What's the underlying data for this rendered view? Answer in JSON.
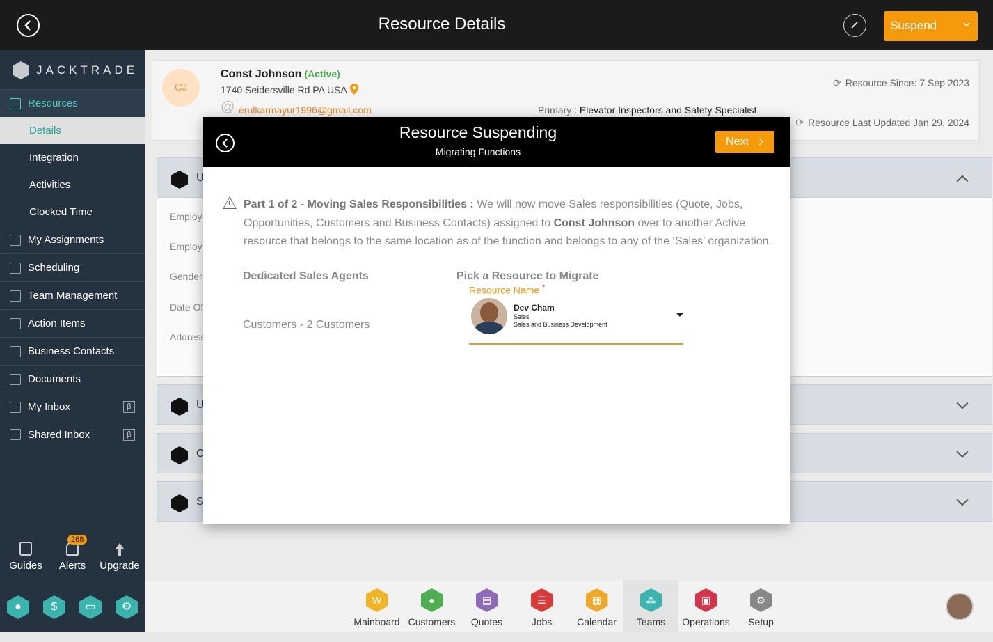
{
  "topbar": {
    "title": "Resource Details",
    "suspend_label": "Suspend"
  },
  "sidebar": {
    "logo_text": "JACKTRADE",
    "items": [
      {
        "label": "Resources",
        "icon": "resources-icon"
      },
      {
        "label": "Details"
      },
      {
        "label": "Integration"
      },
      {
        "label": "Activities"
      },
      {
        "label": "Clocked Time"
      },
      {
        "label": "My Assignments",
        "icon": "assignments-icon"
      },
      {
        "label": "Scheduling",
        "icon": "scheduling-icon"
      },
      {
        "label": "Team Management",
        "icon": "team-management-icon"
      },
      {
        "label": "Action Items",
        "icon": "action-items-icon"
      },
      {
        "label": "Business Contacts",
        "icon": "business-contacts-icon"
      },
      {
        "label": "Documents",
        "icon": "documents-icon"
      },
      {
        "label": "My Inbox",
        "icon": "inbox-icon",
        "badge": "β"
      },
      {
        "label": "Shared Inbox",
        "icon": "shared-inbox-icon",
        "badge": "β"
      }
    ],
    "tools": {
      "guides": "Guides",
      "alerts": "Alerts",
      "alerts_count": "268",
      "upgrade": "Upgrade"
    },
    "quick": [
      "person",
      "$",
      "chat",
      "settings"
    ]
  },
  "profile": {
    "initials": "CJ",
    "name": "Const Johnson",
    "status": "(Active)",
    "address": "1740 Seidersville Rd PA USA",
    "email": "erulkarmayur1996@gmail.com",
    "primary_label": "Primary :",
    "primary_value": "Elevator Inspectors and Safety Specialist",
    "since": "Resource Since: 7 Sep 2023",
    "updated": "Resource Last Updated Jan 29, 2024"
  },
  "sections": {
    "s1": "U",
    "s2": "U",
    "s3": "O",
    "s4": "S",
    "fields": [
      "Employ",
      "Employ",
      "Gender",
      "Date Of",
      "Address"
    ]
  },
  "modal": {
    "title": "Resource Suspending",
    "subtitle": "Migrating Functions",
    "next_label": "Next",
    "part_label": "Part 1 of 2 - Moving Sales Responsibilities :",
    "text_before": " We will now move Sales responsibilities (Quote, Jobs, Opportunities, Customers and Business Contacts) assigned to ",
    "resource_name": "Const Johnson",
    "text_after": " over to another Active resource that belongs to the same location as of the function and belongs to any of the ‘Sales’ organization.",
    "col_left": "Dedicated Sales Agents",
    "col_right": "Pick a Resource to Migrate",
    "customers_line": "Customers - 2 Customers",
    "field_label": "Resource Name",
    "required_mark": "*",
    "selected": {
      "name": "Dev Cham",
      "role": "Sales",
      "department": "Sales and Business Development"
    }
  },
  "bottom_nav": [
    {
      "label": "Mainboard",
      "color": "#f0b429"
    },
    {
      "label": "Customers",
      "color": "#4caf50"
    },
    {
      "label": "Quotes",
      "color": "#8e6bb5"
    },
    {
      "label": "Jobs",
      "color": "#d93a3a"
    },
    {
      "label": "Calendar",
      "color": "#f0a82a"
    },
    {
      "label": "Teams",
      "color": "#3cb4ae"
    },
    {
      "label": "Operations",
      "color": "#d3364a"
    },
    {
      "label": "Setup",
      "color": "#888888"
    }
  ],
  "colors": {
    "accent": "#f59a0a",
    "sidebar_bg": "#25323f",
    "teal": "#3cb4ae"
  }
}
